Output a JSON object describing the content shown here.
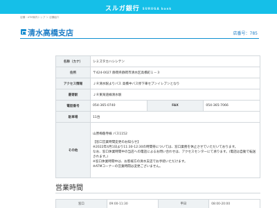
{
  "header": {
    "brand": "スルガ銀行",
    "brand_sub": "SURUGA bank"
  },
  "breadcrumb": "店舗・ATM案内トップ ＞ 店舗紹介",
  "branch": {
    "name": "清水高橋支店",
    "store_number": "店番号：785"
  },
  "info": {
    "name_kana_label": "名称（カナ）",
    "name_kana": "シミズタカハシシテン",
    "address_label": "住所",
    "address": "〒424-0027 静岡県静岡市清水区高橋町１－３",
    "access_label": "アクセス情報",
    "access": "ＪＲ清水駅よりバス 高橋中バス停下車セブンイレブンとなり",
    "station_label": "最寄駅",
    "station": "ＪＲ東海道線清水駅",
    "tel_label": "電話番号",
    "tel": "054-365-0740",
    "fax_label": "FAX",
    "fax": "054-365-7066",
    "parking_label": "駐車場",
    "parking": "11台",
    "other_label": "その他",
    "other_lines": [
      "山原梅蔭寺線 バス1152",
      "",
      "【窓口営業時間変更のお知らせ】",
      "※2022年4月1日より11:30-12:30の時間帯については、窓口業務を休止させていただいております。",
      "なお、窓口休業時間中の当店への電話によるお問い合わせは、アクセスセンターにて承ります。(電話は自動で転送されます。)",
      "※窓口休業時間中は、お客様方の清水支店でお手続いただけます。",
      "※ATMコーナーの営業時間は変更ございません。"
    ]
  },
  "hours": {
    "title": "営業時間",
    "left_label": "窓口",
    "left_value": "09:00-11:30",
    "right_label": "平日",
    "right_value": "08:00-20:00"
  }
}
